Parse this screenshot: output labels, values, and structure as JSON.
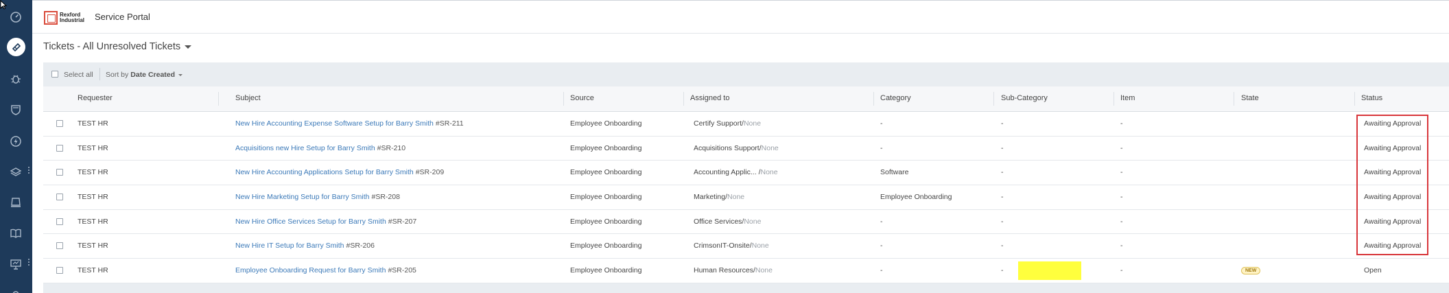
{
  "app": {
    "brand_line1": "Rexford",
    "brand_line2": "Industrial",
    "portal_title": "Service Portal"
  },
  "sidebar": {
    "icons": [
      "dashboard-icon",
      "tickets-icon",
      "bug-icon",
      "shield-icon",
      "bolt-icon",
      "layers-icon",
      "inbox-icon",
      "book-icon",
      "presentation-icon"
    ],
    "active": "tickets-icon"
  },
  "view": {
    "title": "Tickets - All Unresolved Tickets"
  },
  "toolbar": {
    "select_all": "Select all",
    "sort_prefix": "Sort by",
    "sort_field": "Date Created"
  },
  "columns": [
    "Requester",
    "Subject",
    "Source",
    "Assigned to",
    "Category",
    "Sub-Category",
    "Item",
    "State",
    "Status"
  ],
  "rows": [
    {
      "requester": "TEST HR",
      "subject": "New Hire Accounting Expense Software Setup for Barry Smith",
      "id": "#SR-211",
      "source": "Employee Onboarding",
      "group": "Certify Support",
      "agent": "None",
      "category": "-",
      "subcategory": "-",
      "item": "-",
      "state": "",
      "status": "Awaiting Approval"
    },
    {
      "requester": "TEST HR",
      "subject": "Acquisitions new Hire Setup for Barry Smith",
      "id": "#SR-210",
      "source": "Employee Onboarding",
      "group": "Acquisitions Support",
      "agent": "None",
      "category": "-",
      "subcategory": "-",
      "item": "-",
      "state": "",
      "status": "Awaiting Approval"
    },
    {
      "requester": "TEST HR",
      "subject": "New Hire Accounting Applications Setup for Barry Smith",
      "id": "#SR-209",
      "source": "Employee Onboarding",
      "group": "Accounting Applic... ",
      "agent": "None",
      "category": "Software",
      "subcategory": "-",
      "item": "-",
      "state": "",
      "status": "Awaiting Approval"
    },
    {
      "requester": "TEST HR",
      "subject": "New Hire Marketing Setup for Barry Smith",
      "id": "#SR-208",
      "source": "Employee Onboarding",
      "group": "Marketing",
      "agent": "None",
      "category": "Employee Onboarding",
      "subcategory": "-",
      "item": "-",
      "state": "",
      "status": "Awaiting Approval"
    },
    {
      "requester": "TEST HR",
      "subject": "New Hire Office Services Setup for Barry Smith",
      "id": "#SR-207",
      "source": "Employee Onboarding",
      "group": "Office Services",
      "agent": "None",
      "category": "-",
      "subcategory": "-",
      "item": "-",
      "state": "",
      "status": "Awaiting Approval"
    },
    {
      "requester": "TEST HR",
      "subject": "New Hire IT Setup for Barry Smith",
      "id": "#SR-206",
      "source": "Employee Onboarding",
      "group": "CrimsonIT-Onsite",
      "agent": "None",
      "category": "-",
      "subcategory": "-",
      "item": "-",
      "state": "",
      "status": "Awaiting Approval"
    },
    {
      "requester": "TEST HR",
      "subject": "Employee Onboarding Request for Barry Smith",
      "id": "#SR-205",
      "source": "Employee Onboarding",
      "group": "Human Resources",
      "agent": "None",
      "category": "-",
      "subcategory": "-",
      "item": "-",
      "state": "NEW",
      "status": "Open"
    }
  ],
  "colors": {
    "sidebar_bg": "#1e3a5a",
    "link": "#3b79b8",
    "highlight_yellow": "#ffff3d",
    "annotation_red": "#d8353a"
  }
}
